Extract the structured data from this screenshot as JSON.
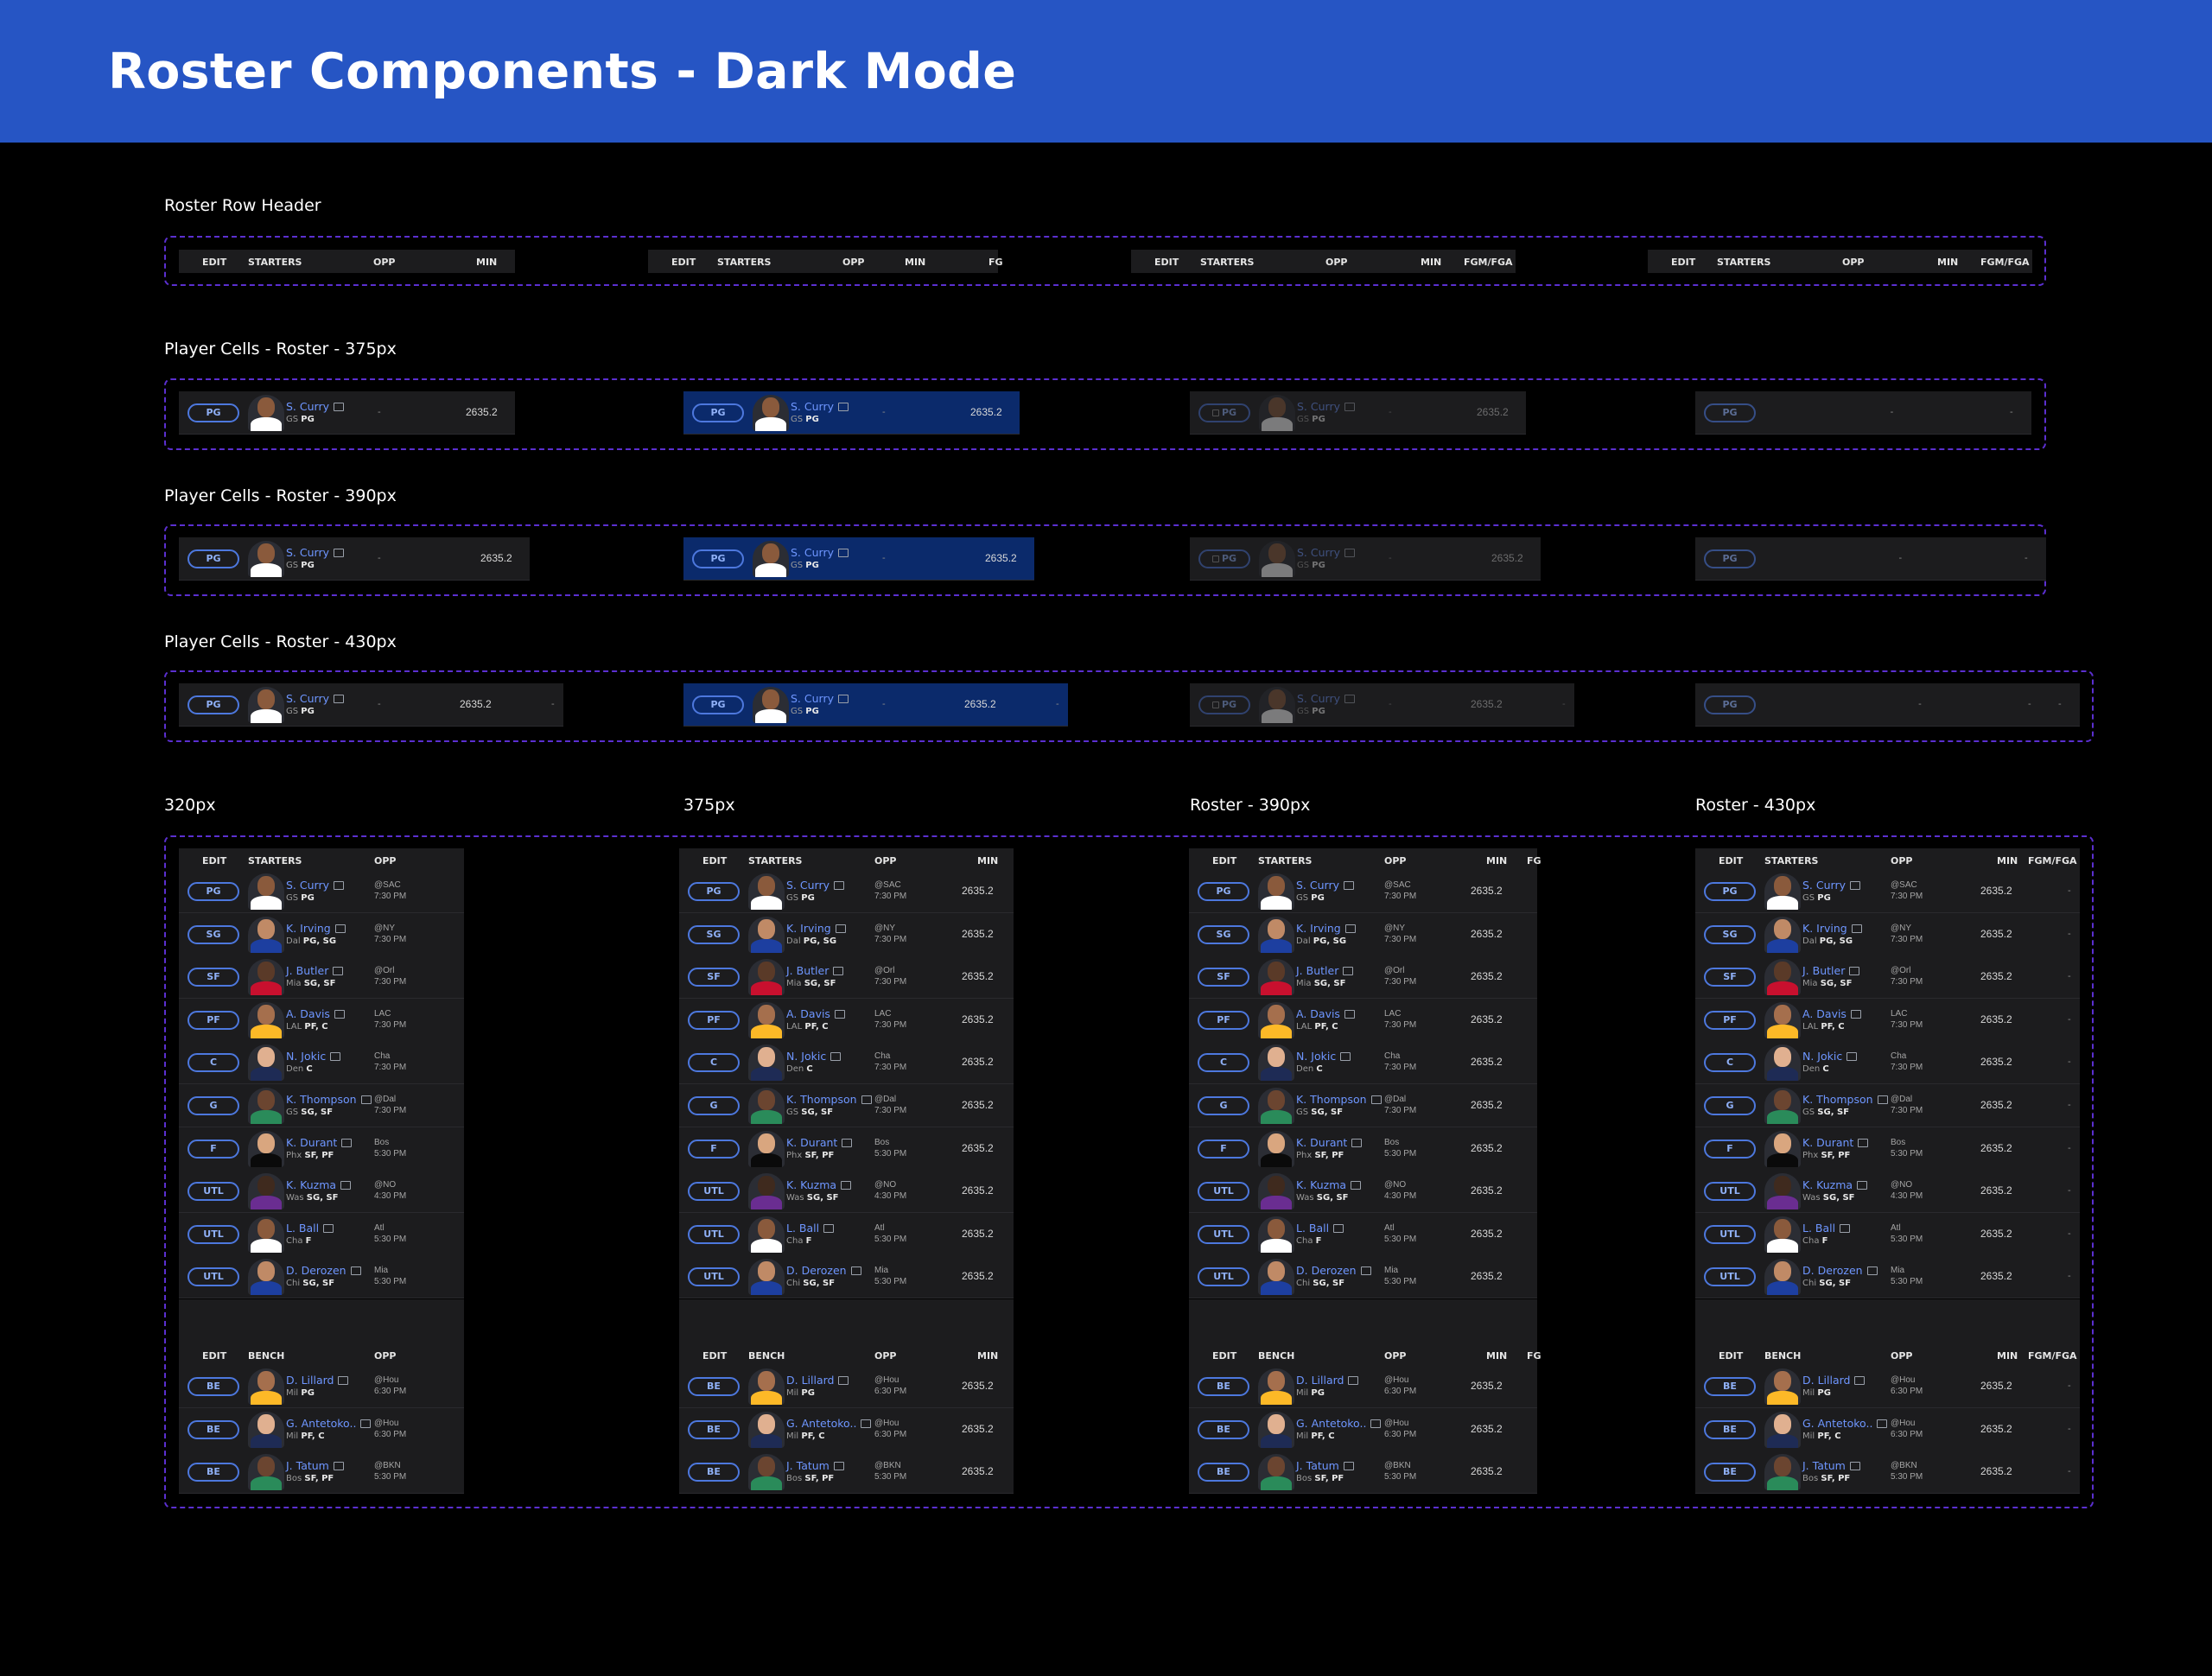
{
  "page_title": "Roster Components - Dark Mode",
  "sections": {
    "header": "Roster Row Header",
    "cells375": "Player Cells - Roster - 375px",
    "cells390": "Player Cells - Roster - 390px",
    "cells430": "Player Cells - Roster - 430px",
    "col320": "320px",
    "col375": "375px",
    "col390": "Roster - 390px",
    "col430": "Roster - 430px"
  },
  "columns": {
    "edit": "EDIT",
    "starters": "STARTERS",
    "bench": "BENCH",
    "opp": "OPP",
    "min": "MIN",
    "fg_cut": "FG",
    "fgm_fga": "FGM/FGA"
  },
  "sample_player": {
    "pos": "PG",
    "name": "S. Curry",
    "team": "GS",
    "elig": "PG",
    "value": "2635.2",
    "dash": "-"
  },
  "starters": [
    {
      "pos": "PG",
      "name": "S. Curry",
      "team": "GS",
      "elig": "PG",
      "opp1": "@SAC",
      "opp2": "7:30 PM",
      "min": "2635.2",
      "fg": "-"
    },
    {
      "pos": "SG",
      "name": "K. Irving",
      "team": "Dal",
      "elig": "PG, SG",
      "opp1": "@NY",
      "opp2": "7:30 PM",
      "min": "2635.2",
      "fg": "-"
    },
    {
      "pos": "SF",
      "name": "J. Butler",
      "team": "Mia",
      "elig": "SG, SF",
      "opp1": "@Orl",
      "opp2": "7:30 PM",
      "min": "2635.2",
      "fg": "-"
    },
    {
      "pos": "PF",
      "name": "A. Davis",
      "team": "LAL",
      "elig": "PF, C",
      "opp1": "LAC",
      "opp2": "7:30 PM",
      "min": "2635.2",
      "fg": "-"
    },
    {
      "pos": "C",
      "name": "N. Jokic",
      "team": "Den",
      "elig": "C",
      "opp1": "Cha",
      "opp2": "7:30 PM",
      "min": "2635.2",
      "fg": "-"
    },
    {
      "pos": "G",
      "name": "K. Thompson",
      "team": "GS",
      "elig": "SG, SF",
      "opp1": "@Dal",
      "opp2": "7:30 PM",
      "min": "2635.2",
      "fg": "-"
    },
    {
      "pos": "F",
      "name": "K. Durant",
      "team": "Phx",
      "elig": "SF, PF",
      "opp1": "Bos",
      "opp2": "5:30 PM",
      "min": "2635.2",
      "fg": "-"
    },
    {
      "pos": "UTL",
      "name": "K. Kuzma",
      "team": "Was",
      "elig": "SG, SF",
      "opp1": "@NO",
      "opp2": "4:30 PM",
      "min": "2635.2",
      "fg": "-"
    },
    {
      "pos": "UTL",
      "name": "L. Ball",
      "team": "Cha",
      "elig": "F",
      "opp1": "Atl",
      "opp2": "5:30 PM",
      "min": "2635.2",
      "fg": "-"
    },
    {
      "pos": "UTL",
      "name": "D. Derozen",
      "team": "Chi",
      "elig": "SG, SF",
      "opp1": "Mia",
      "opp2": "5:30 PM",
      "min": "2635.2",
      "fg": "-"
    }
  ],
  "bench": [
    {
      "pos": "BE",
      "name": "D. Lillard",
      "team": "Mil",
      "elig": "PG",
      "opp1": "@Hou",
      "opp2": "6:30 PM",
      "min": "2635.2",
      "fg": "-"
    },
    {
      "pos": "BE",
      "name": "G. Antetoko..",
      "team": "Mil",
      "elig": "PF, C",
      "opp1": "@Hou",
      "opp2": "6:30 PM",
      "min": "2635.2",
      "fg": "-"
    },
    {
      "pos": "BE",
      "name": "J. Tatum",
      "team": "Bos",
      "elig": "SF, PF",
      "opp1": "@BKN",
      "opp2": "5:30 PM",
      "min": "2635.2",
      "fg": "-"
    }
  ],
  "colors": {
    "banner": "#2655c4",
    "accent": "#6e96ff",
    "selected_row": "#0b2a6b",
    "dashed_border": "#5b2fd0",
    "row_bg": "#1c1c1e"
  },
  "icons": {
    "news": "news-icon",
    "lock": "lock-icon",
    "avatar": "player-avatar"
  }
}
